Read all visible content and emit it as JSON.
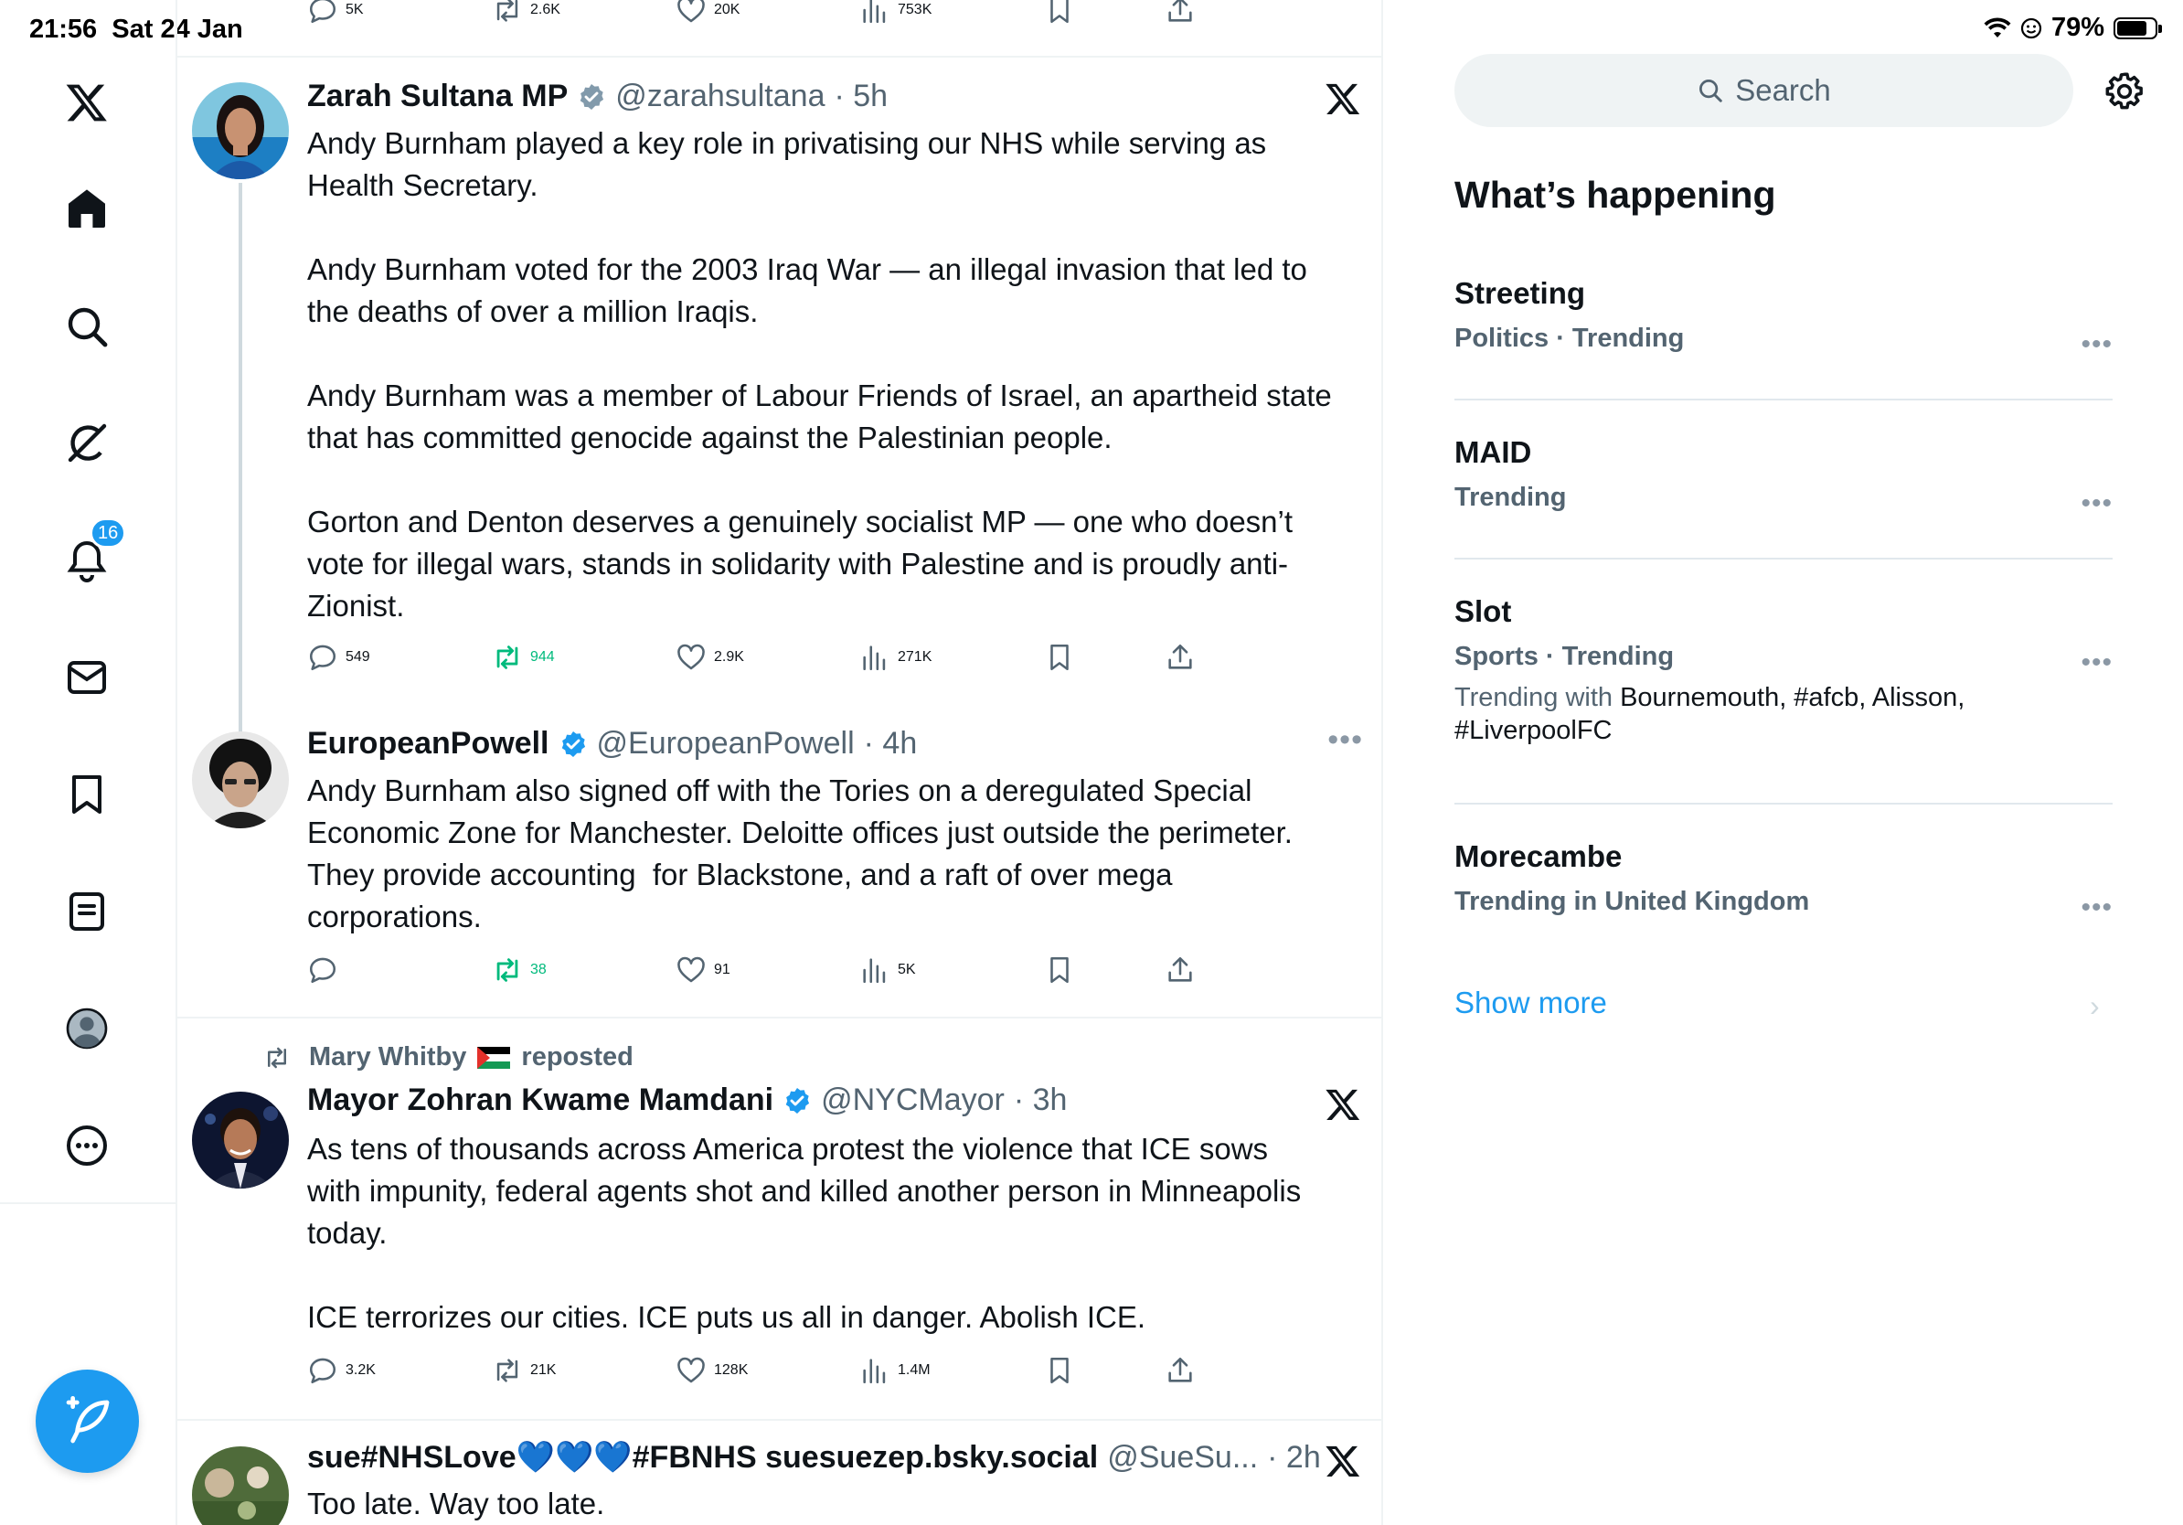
{
  "status_bar": {
    "time": "21:56",
    "date": "Sat 24 Jan",
    "battery": "79%",
    "battery_level": 0.79
  },
  "nav": {
    "items": [
      {
        "name": "x-logo-icon"
      },
      {
        "name": "home-icon"
      },
      {
        "name": "search-icon"
      },
      {
        "name": "grok-icon"
      },
      {
        "name": "notifications-icon",
        "badge": "16"
      },
      {
        "name": "messages-icon"
      },
      {
        "name": "bookmarks-icon"
      },
      {
        "name": "lists-icon"
      },
      {
        "name": "profile-icon"
      },
      {
        "name": "more-icon"
      }
    ],
    "compose": "compose-icon"
  },
  "top_actions": {
    "replies": "5K",
    "reposts": "2.6K",
    "likes": "20K",
    "views": "753K"
  },
  "tweets": [
    {
      "name": "Zarah Sultana MP",
      "handle": "@zarahsultana",
      "time": "· 5h",
      "text": "Andy Burnham played a key role in privatising our NHS while serving as\nHealth Secretary.\n\nAndy Burnham voted for the 2003 Iraq War — an illegal invasion that led to\nthe deaths of over a million Iraqis.\n\nAndy Burnham was a member of Labour Friends of Israel, an apartheid state\nthat has committed genocide against the Palestinian people.\n\nGorton and Denton deserves a genuinely socialist MP — one who doesn’t\nvote for illegal wars, stands in solidarity with Palestine and is proudly anti-\nZionist.",
      "replies": "549",
      "reposts": "944",
      "likes": "2.9K",
      "views": "271K"
    },
    {
      "name": "EuropeanPowell",
      "handle": "@EuropeanPowell",
      "time": "· 4h",
      "text": "Andy Burnham also signed off with the Tories on a deregulated Special\nEconomic Zone for Manchester. Deloitte offices just outside the perimeter.\nThey provide accounting  for Blackstone, and a raft of over mega\ncorporations.",
      "replies": "",
      "reposts": "38",
      "likes": "91",
      "views": "5K"
    },
    {
      "repost_by": "Mary Whitby",
      "repost_suffix": "reposted",
      "name": "Mayor Zohran Kwame Mamdani",
      "handle": "@NYCMayor",
      "time": "· 3h",
      "text": "As tens of thousands across America protest the violence that ICE sows\nwith impunity, federal agents shot and killed another person in Minneapolis\ntoday.\n\nICE terrorizes our cities. ICE puts us all in danger. Abolish ICE.",
      "replies": "3.2K",
      "reposts": "21K",
      "likes": "128K",
      "views": "1.4M"
    },
    {
      "name": "sue#NHSLove💙💙💙#FBNHS suesuezep.bsky.social",
      "handle": "@SueSu...",
      "time": "· 2h",
      "text": "Too late. Way too late."
    }
  ],
  "sidebar": {
    "search_placeholder": "Search",
    "title": "What’s happening",
    "trends": [
      {
        "name": "Streeting",
        "meta": "Politics · Trending"
      },
      {
        "name": "MAID",
        "meta": "Trending"
      },
      {
        "name": "Slot",
        "meta": "Sports · Trending",
        "with_prefix": "Trending with",
        "with": "Bournemouth, #afcb, Alisson,\n#LiverpoolFC"
      },
      {
        "name": "Morecambe",
        "meta": "Trending in United Kingdom"
      }
    ],
    "show_more": "Show more"
  },
  "colors": {
    "accent": "#1d9bf0",
    "repost_green": "#00ba7c",
    "muted": "#536471"
  }
}
